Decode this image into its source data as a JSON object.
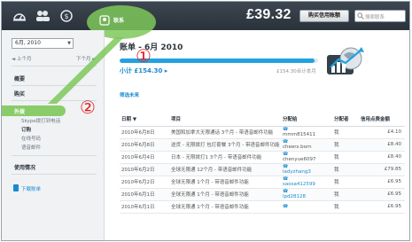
{
  "topbar": {
    "contacts_label": "联系",
    "balance": "£39.32",
    "buy_credit_label": "购买信用账额",
    "search_placeholder": "搜索联系"
  },
  "sidebar": {
    "date_value": "6月, 2010",
    "prev_month": "◄ 上个月",
    "next_month": "下个月 ►",
    "sections": [
      {
        "label": "概要"
      },
      {
        "label": "购买"
      }
    ],
    "outgoing_label": "外拨",
    "sub_items": [
      "Skype拨打到电话",
      "订购",
      "在线号码",
      "语音邮件"
    ],
    "usage_label": "使用情况",
    "download_label": "下载账单"
  },
  "annotations": {
    "marker_1": "①",
    "marker_2": "②"
  },
  "main": {
    "bill_title": "账单 - 6月 2010",
    "progress_fraction": 0.98,
    "subtotal": "小计 £154.30 ▸",
    "month_range": "£154.30合计本月",
    "filter_link": "筛选未来"
  },
  "table": {
    "headers": [
      "日期 ▼",
      "项目",
      "分配给",
      "分配者",
      "信用点费金额"
    ],
    "rows": [
      {
        "date": "2010年6月8日",
        "item": "美国和加拿大无限通话 3个月 - 带语音邮件功能",
        "assignee": "mmm815411",
        "assigner": "我",
        "amount": "£4.10"
      },
      {
        "date": "2010年6月8日",
        "item": "送货 - 无限拨打 包打套餐 3个月 - 带语音邮件功能",
        "assignee": "cheers.born",
        "assigner": "我",
        "amount": "£8.40"
      },
      {
        "date": "2010年6月4日",
        "item": "日本 - 无限拨打1 3个月 - 带语音邮件功能",
        "assignee": "chenyue6097",
        "assigner": "我",
        "amount": "£8.40"
      },
      {
        "date": "2010年6月2日",
        "item": "全球无限通 12个月 - 带语音邮件功能",
        "assignee": "ladyzhang3",
        "assigner": "我",
        "amount": "£79.85"
      },
      {
        "date": "2010年6月2日",
        "item": "全球无限通 1个月 - 带语音邮件功能",
        "assignee": "saosa412599",
        "assigner": "我",
        "amount": "£6.95"
      },
      {
        "date": "2010年6月1日",
        "item": "全球无限通 1个月 - 带语音邮件功能",
        "assignee": "lpd28128",
        "assigner": "我",
        "amount": "£6.95"
      },
      {
        "date": "2010年6月1日",
        "item": "全球无限通 1个月 - 带语音邮件功能",
        "assignee": "",
        "assigner": "我",
        "amount": "£6.95"
      }
    ]
  },
  "colors": {
    "topbar": "#2f3840",
    "accent_blue": "#21a3e0",
    "callout_green": "#7ec85a",
    "marker_red": "#e02020"
  }
}
